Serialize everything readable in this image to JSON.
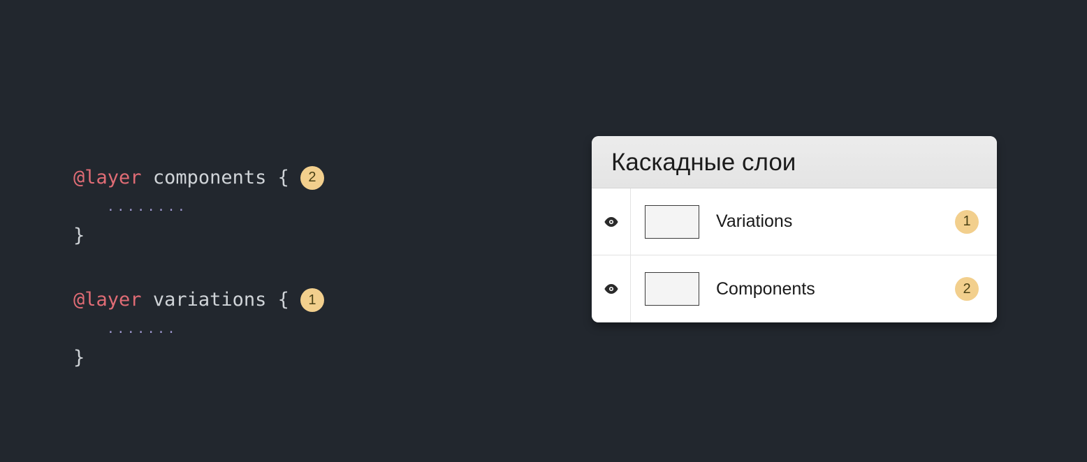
{
  "code": {
    "block1": {
      "keyword": "@layer",
      "name": "components",
      "open": "{",
      "dots": "........",
      "close": "}",
      "badge": "2"
    },
    "block2": {
      "keyword": "@layer",
      "name": "variations",
      "open": "{",
      "dots": ".......",
      "close": "}",
      "badge": "1"
    }
  },
  "panel": {
    "title": "Каскадные слои",
    "rows": [
      {
        "label": "Variations",
        "badge": "1"
      },
      {
        "label": "Components",
        "badge": "2"
      }
    ]
  },
  "colors": {
    "badge_bg": "#f2cf8d",
    "keyword": "#e06c75"
  }
}
